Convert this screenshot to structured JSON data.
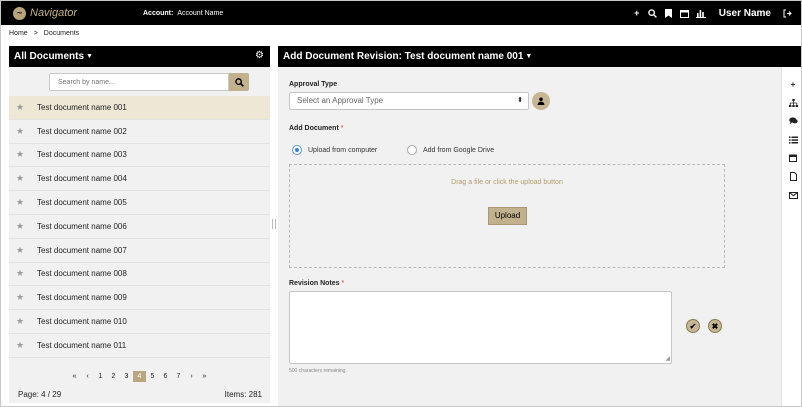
{
  "topbar": {
    "app_name": "Navigator",
    "account_label": "Account:",
    "account_value": "Account Name",
    "username": "User Name",
    "icons": [
      "plus-icon",
      "search-icon",
      "bookmark-icon",
      "calendar-icon",
      "bar-chart-icon",
      "logout-icon"
    ]
  },
  "breadcrumb": {
    "home": "Home",
    "separator": ">",
    "current": "Documents"
  },
  "left_panel": {
    "title": "All Documents",
    "search_placeholder": "Search by name...",
    "documents": [
      "Test document name 001",
      "Test document name 002",
      "Test document name 003",
      "Test document name 004",
      "Test document name 005",
      "Test document name 006",
      "Test document name 007",
      "Test document name 008",
      "Test document name 009",
      "Test document name 010",
      "Test document name 011"
    ],
    "active_index": 0,
    "pagination": {
      "first": "«",
      "prev": "‹",
      "pages": [
        "1",
        "2",
        "3",
        "4",
        "5",
        "6",
        "7"
      ],
      "current": "4",
      "next": "›",
      "last": "»"
    },
    "page_info": "Page: 4 / 29",
    "items_info": "Items: 281"
  },
  "right_panel": {
    "title": "Add Document Revision: Test document name 001",
    "approval_type": {
      "label": "Approval Type",
      "placeholder": "Select an Approval Type"
    },
    "add_document": {
      "label": "Add Document",
      "required_mark": "*",
      "option_computer": "Upload from computer",
      "option_drive": "Add from Google Drive",
      "selected": "computer",
      "drop_text": "Drag a file or click the upload button",
      "upload_button": "Upload"
    },
    "revision_notes": {
      "label": "Revision Notes",
      "required_mark": "*",
      "value": "",
      "chars_remaining": "500 characters remaining."
    },
    "side_icons": [
      "plus-icon",
      "sitemap-icon",
      "comments-icon",
      "list-icon",
      "calendar-icon",
      "document-icon",
      "envelope-icon"
    ]
  }
}
